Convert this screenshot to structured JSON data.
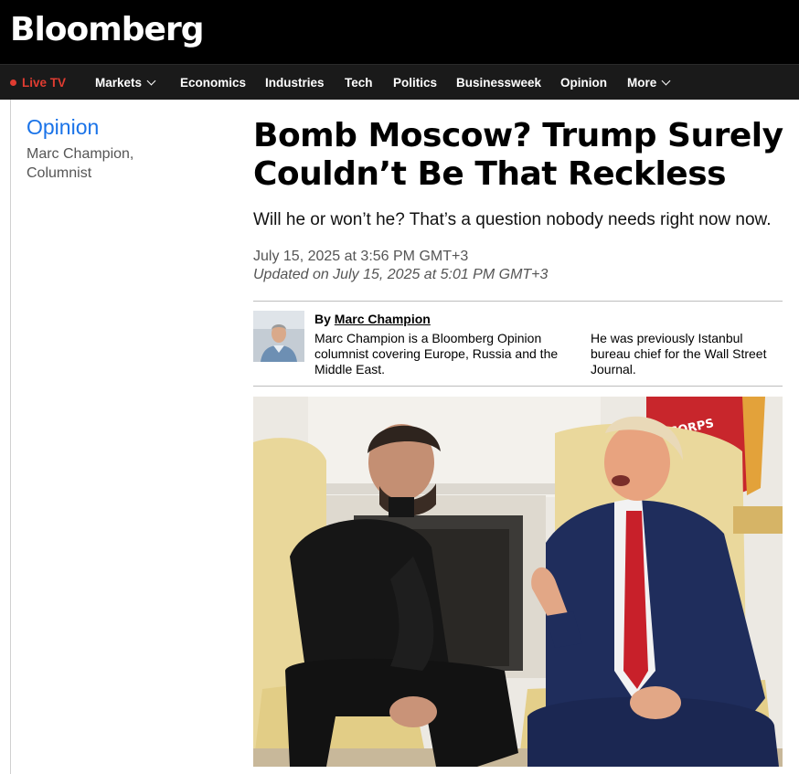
{
  "brand": {
    "logo": "Bloomberg"
  },
  "nav": {
    "live": "Live TV",
    "items": [
      "Markets",
      "Economics",
      "Industries",
      "Tech",
      "Politics",
      "Businessweek",
      "Opinion",
      "More"
    ]
  },
  "rail": {
    "section": "Opinion",
    "author_line1": "Marc Champion,",
    "author_line2": "Columnist"
  },
  "article": {
    "headline_line1": "Bomb Moscow? Trump Surely",
    "headline_line2": "Couldn’t Be That Reckless",
    "dek": "Will he or won’t he? That’s a question nobody needs right now now.",
    "published": "July 15, 2025 at 3:56 PM GMT+3",
    "updated": "Updated on July 15, 2025 at 5:01 PM GMT+3",
    "author": {
      "by": "By",
      "name": "Marc Champion",
      "bio_col1": "Marc Champion is a Bloomberg Opinion columnist covering Europe, Russia and the Middle East.",
      "bio_col2": "He was previously Istanbul bureau chief for the Wall Street Journal."
    },
    "photo_flag_text": "CORPS"
  },
  "colors": {
    "accent_blue": "#1a73e8",
    "live_red": "#e03c31",
    "header_bg": "#000000"
  }
}
